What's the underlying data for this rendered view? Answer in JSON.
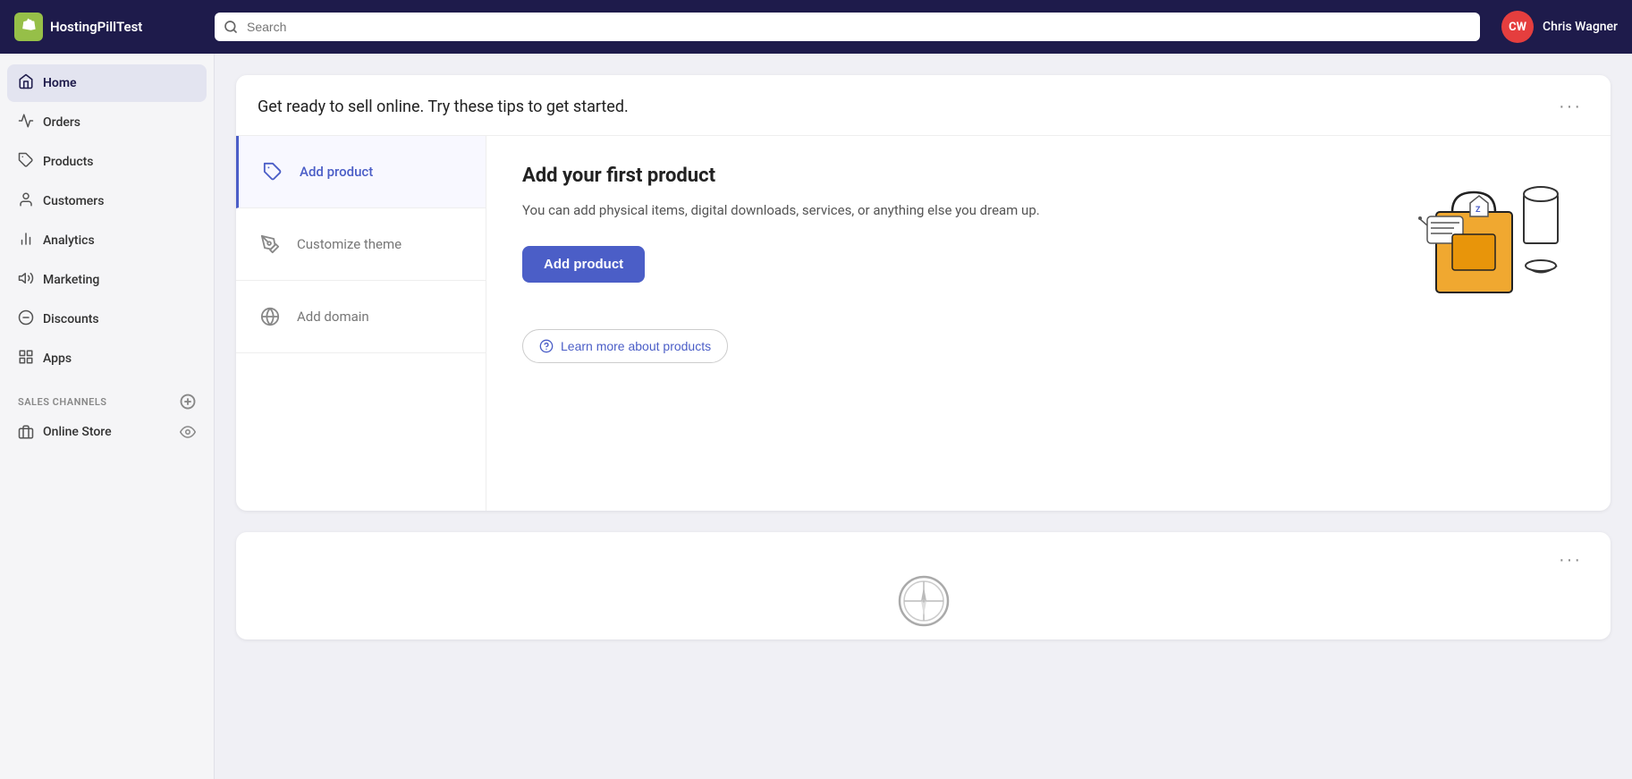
{
  "topbar": {
    "brand": "HostingPillTest",
    "shopify_initial": "S",
    "search_placeholder": "Search",
    "user_initials": "CW",
    "user_name": "Chris Wagner"
  },
  "sidebar": {
    "nav_items": [
      {
        "id": "home",
        "label": "Home",
        "active": true
      },
      {
        "id": "orders",
        "label": "Orders",
        "active": false
      },
      {
        "id": "products",
        "label": "Products",
        "active": false
      },
      {
        "id": "customers",
        "label": "Customers",
        "active": false
      },
      {
        "id": "analytics",
        "label": "Analytics",
        "active": false
      },
      {
        "id": "marketing",
        "label": "Marketing",
        "active": false
      },
      {
        "id": "discounts",
        "label": "Discounts",
        "active": false
      },
      {
        "id": "apps",
        "label": "Apps",
        "active": false
      }
    ],
    "sales_channels_label": "SALES CHANNELS",
    "online_store_label": "Online Store"
  },
  "main_card": {
    "title": "Get ready to sell online. Try these tips to get started.",
    "more_label": "···",
    "steps": [
      {
        "id": "add-product",
        "label": "Add product",
        "active": true
      },
      {
        "id": "customize-theme",
        "label": "Customize theme",
        "active": false
      },
      {
        "id": "add-domain",
        "label": "Add domain",
        "active": false
      }
    ],
    "active_step": {
      "title": "Add your first product",
      "description": "You can add physical items, digital downloads, services, or anything else you dream up.",
      "cta_label": "Add product",
      "learn_more_label": "Learn more about products"
    }
  },
  "second_card": {
    "more_label": "···"
  }
}
